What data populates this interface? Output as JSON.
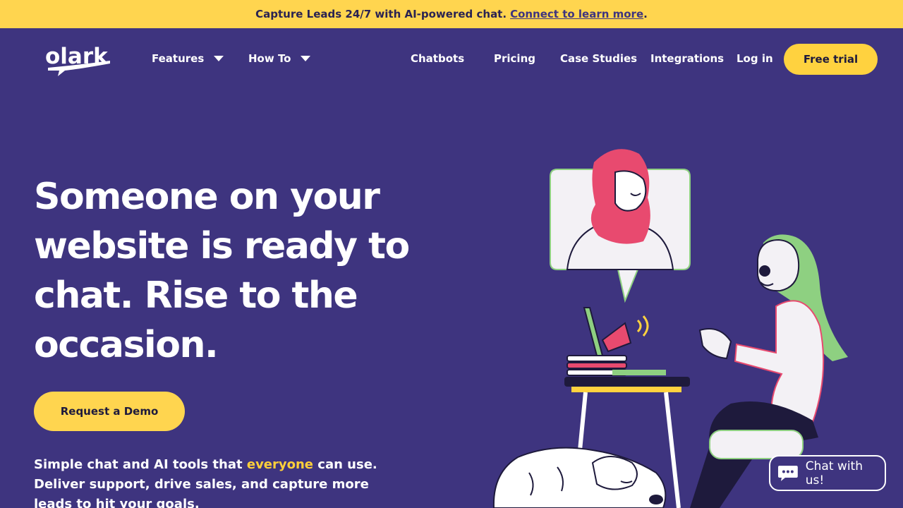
{
  "banner": {
    "text": "Capture Leads 24/7 with AI-powered chat.",
    "link": "Connect to learn more",
    "suffix": "."
  },
  "nav": {
    "logo_text": "olark",
    "features": "Features",
    "how_to": "How To",
    "chatbots": "Chatbots",
    "pricing": "Pricing",
    "case_studies": "Case Studies",
    "integrations": "Integrations",
    "login": "Log in",
    "free_trial": "Free trial"
  },
  "hero": {
    "title": "Someone on your website is ready to chat. Rise to the occasion.",
    "cta": "Request a Demo",
    "sub_before": "Simple chat and AI tools that ",
    "sub_highlight": "everyone",
    "sub_after": " can use. Deliver support, drive sales, and capture more leads to hit your goals."
  },
  "chat_widget": {
    "label": "Chat with us!"
  },
  "colors": {
    "background": "#3e347f",
    "banner": "#ffd54f",
    "accent": "#ffd23f",
    "highlight": "#ffcf3a"
  }
}
